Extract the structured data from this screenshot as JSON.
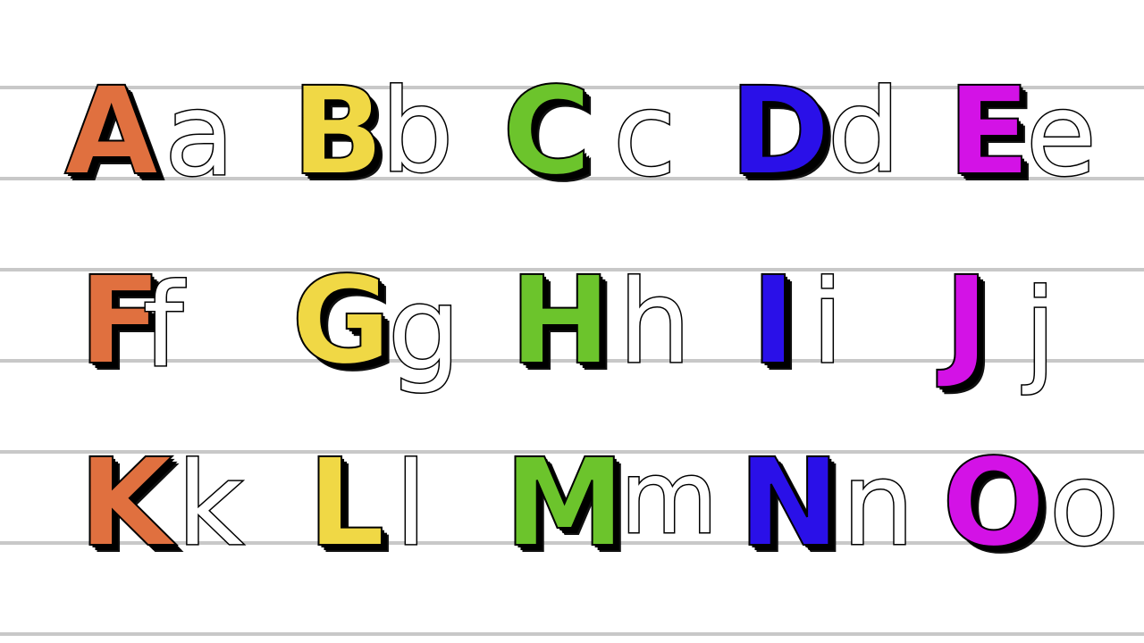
{
  "colors": {
    "background": "#ffffff",
    "rule_line": "#c8c8c8",
    "orange": "#e0703f",
    "yellow": "#f0d845",
    "green": "#6cc42c",
    "blue": "#2a10e8",
    "magenta": "#d312e6"
  },
  "rows": [
    {
      "pairs": [
        {
          "upper": "A",
          "lower": "a",
          "color": "#e0703f"
        },
        {
          "upper": "B",
          "lower": "b",
          "color": "#f0d845"
        },
        {
          "upper": "C",
          "lower": "c",
          "color": "#6cc42c"
        },
        {
          "upper": "D",
          "lower": "d",
          "color": "#2a10e8"
        },
        {
          "upper": "E",
          "lower": "e",
          "color": "#d312e6"
        }
      ]
    },
    {
      "pairs": [
        {
          "upper": "F",
          "lower": "f",
          "color": "#e0703f"
        },
        {
          "upper": "G",
          "lower": "g",
          "color": "#f0d845"
        },
        {
          "upper": "H",
          "lower": "h",
          "color": "#6cc42c"
        },
        {
          "upper": "I",
          "lower": "i",
          "color": "#2a10e8"
        },
        {
          "upper": "J",
          "lower": "j",
          "color": "#d312e6"
        }
      ]
    },
    {
      "pairs": [
        {
          "upper": "K",
          "lower": "k",
          "color": "#e0703f"
        },
        {
          "upper": "L",
          "lower": "l",
          "color": "#f0d845"
        },
        {
          "upper": "M",
          "lower": "m",
          "color": "#6cc42c"
        },
        {
          "upper": "N",
          "lower": "n",
          "color": "#2a10e8"
        },
        {
          "upper": "O",
          "lower": "o",
          "color": "#d312e6"
        }
      ]
    }
  ]
}
